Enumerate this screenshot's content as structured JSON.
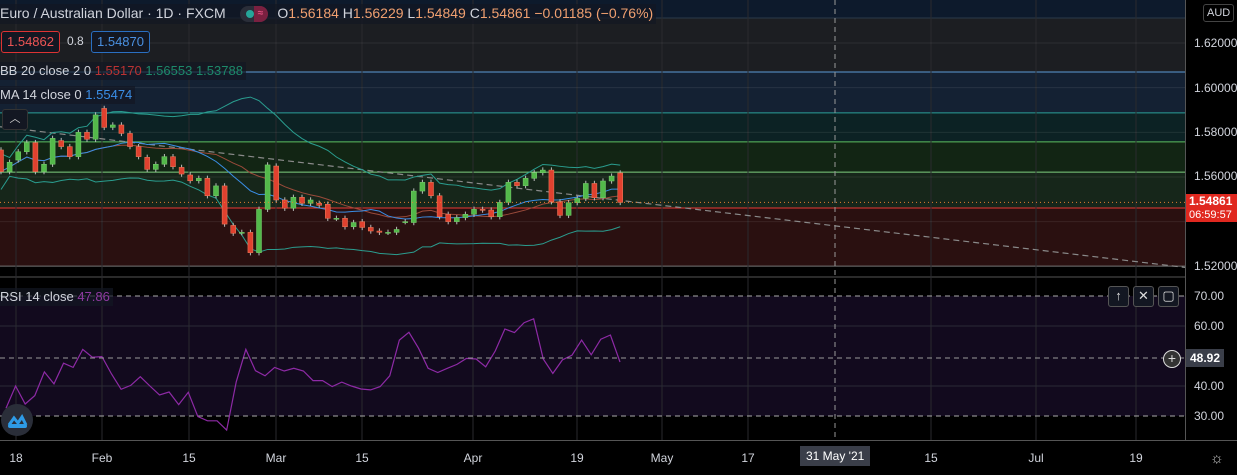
{
  "header": {
    "symbol": "Euro / Australian Dollar · 1D · FXCM",
    "open_k": "O",
    "open": "1.56184",
    "high_k": "H",
    "high": "1.56229",
    "low_k": "L",
    "low": "1.54849",
    "close_k": "C",
    "close": "1.54861",
    "change": "−0.01185 (−0.76%)",
    "bid": "1.54862",
    "spread": "0.8",
    "ask": "1.54870"
  },
  "indicators": {
    "bb_label": "BB 20 close 2 0",
    "bb_basis": "1.55170",
    "bb_upper": "1.56553",
    "bb_lower": "1.53788",
    "ma_label": "MA 14 close 0",
    "ma_value": "1.55474",
    "rsi_label": "RSI 14 close",
    "rsi_value": "47.86"
  },
  "price_axis": {
    "currency": "AUD",
    "ticks": [
      "1.62000",
      "1.60000",
      "1.58000",
      "1.56000",
      "1.52000"
    ],
    "last_price": "1.54861",
    "countdown": "06:59:57",
    "rsi_ticks": [
      "70.00",
      "60.00",
      "40.00",
      "30.00"
    ],
    "crosshair_value": "48.92"
  },
  "time_axis": {
    "ticks": [
      "18",
      "Feb",
      "15",
      "Mar",
      "15",
      "Apr",
      "19",
      "May",
      "17",
      "15",
      "Jul",
      "19"
    ],
    "crosshair_date": "31 May '21"
  },
  "colors": {
    "up": "#53b94a",
    "down": "#e0412f",
    "rsi": "#8e2aa6",
    "bb": "#2a9d8f",
    "ma": "#3a8ee6"
  },
  "chart_data": {
    "type": "candlestick",
    "price_range": [
      1.515,
      1.64
    ],
    "fib_levels": [
      1.6312,
      1.607,
      1.5887,
      1.5757,
      1.5622,
      1.5461,
      1.5201
    ],
    "trendline": [
      1.5825,
      1.5195
    ],
    "open": [
      1.5721,
      1.5624,
      1.5676,
      1.5713,
      1.5754,
      1.5624,
      1.5657,
      1.5763,
      1.5736,
      1.5691,
      1.58,
      1.5769,
      1.5907,
      1.5822,
      1.5833,
      1.5795,
      1.5736,
      1.5688,
      1.5634,
      1.5657,
      1.5691,
      1.5643,
      1.5609,
      1.5583,
      1.5594,
      1.5516,
      1.556,
      1.5383,
      1.5351,
      1.5352,
      1.5261,
      1.5455,
      1.5649,
      1.5497,
      1.546,
      1.5509,
      1.5482,
      1.5482,
      1.5478,
      1.5415,
      1.5415,
      1.5377,
      1.54,
      1.5374,
      1.5358,
      1.5352,
      1.5352,
      1.54,
      1.5396,
      1.5537,
      1.5576,
      1.5516,
      1.5433,
      1.54,
      1.5418,
      1.5433,
      1.5455,
      1.5452,
      1.5422,
      1.5486,
      1.5576,
      1.5561,
      1.5594,
      1.5619,
      1.5631,
      1.5489,
      1.5428,
      1.5485,
      1.5504,
      1.5571,
      1.5507,
      1.5582,
      1.5618
    ],
    "close": [
      1.5624,
      1.5666,
      1.5713,
      1.5754,
      1.5624,
      1.5657,
      1.5773,
      1.5736,
      1.5691,
      1.58,
      1.5769,
      1.5878,
      1.5822,
      1.5833,
      1.5795,
      1.5736,
      1.5691,
      1.5634,
      1.5657,
      1.5691,
      1.5646,
      1.5613,
      1.5583,
      1.5594,
      1.5516,
      1.556,
      1.5389,
      1.5348,
      1.5352,
      1.5261,
      1.5455,
      1.5654,
      1.5497,
      1.546,
      1.5509,
      1.5482,
      1.5497,
      1.5473,
      1.5415,
      1.5415,
      1.5377,
      1.5396,
      1.5374,
      1.5358,
      1.5352,
      1.5352,
      1.5365,
      1.54,
      1.5537,
      1.5576,
      1.5516,
      1.5422,
      1.54,
      1.5418,
      1.5433,
      1.5455,
      1.5452,
      1.5422,
      1.5486,
      1.5576,
      1.5561,
      1.5594,
      1.5619,
      1.5631,
      1.5489,
      1.5428,
      1.5485,
      1.5504,
      1.5571,
      1.5507,
      1.5582,
      1.5604,
      1.5486
    ],
    "rsi": [
      32.6,
      40.0,
      34.0,
      36.8,
      44.7,
      40.7,
      47.6,
      46.2,
      52.2,
      49.6,
      49.8,
      44.0,
      38.9,
      40.2,
      43.1,
      40.0,
      37.0,
      38.0,
      33.8,
      37.9,
      29.8,
      28.4,
      28.4,
      25.3,
      41.4,
      52.2,
      45.1,
      43.4,
      46.2,
      45.0,
      45.9,
      45.0,
      41.8,
      41.8,
      39.8,
      41.3,
      40.0,
      39.0,
      38.7,
      39.8,
      43.4,
      55.3,
      57.9,
      52.6,
      45.9,
      44.5,
      45.9,
      47.2,
      49.2,
      49.0,
      46.4,
      51.7,
      59.0,
      57.8,
      61.1,
      62.4,
      49.0,
      44.2,
      48.7,
      50.3,
      55.3,
      50.4,
      55.6,
      57.0,
      48.0
    ],
    "rsi_range": [
      20,
      76.3
    ]
  }
}
